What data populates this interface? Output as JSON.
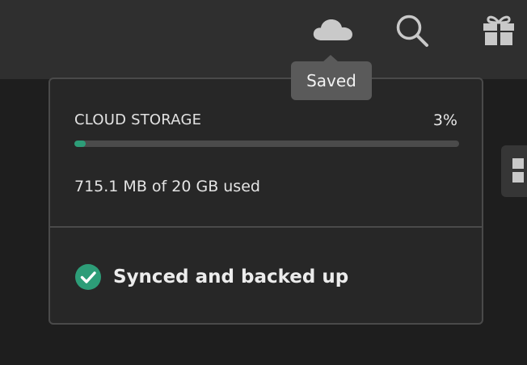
{
  "toolbar": {
    "icons": [
      "cloud-icon",
      "search-icon",
      "gift-icon"
    ]
  },
  "tooltip": {
    "text": "Saved"
  },
  "storage_panel": {
    "title": "CLOUD STORAGE",
    "percent_label": "3%",
    "percent_used": 0.03,
    "usage_text": "715.1 MB of 20 GB used",
    "sync_status": "Synced and backed up"
  },
  "colors": {
    "topbar": "#2f2f2f",
    "background": "#1e1e1e",
    "panel": "#272727",
    "accent_green": "#2d9d78",
    "tooltip": "#5a5a5a"
  }
}
